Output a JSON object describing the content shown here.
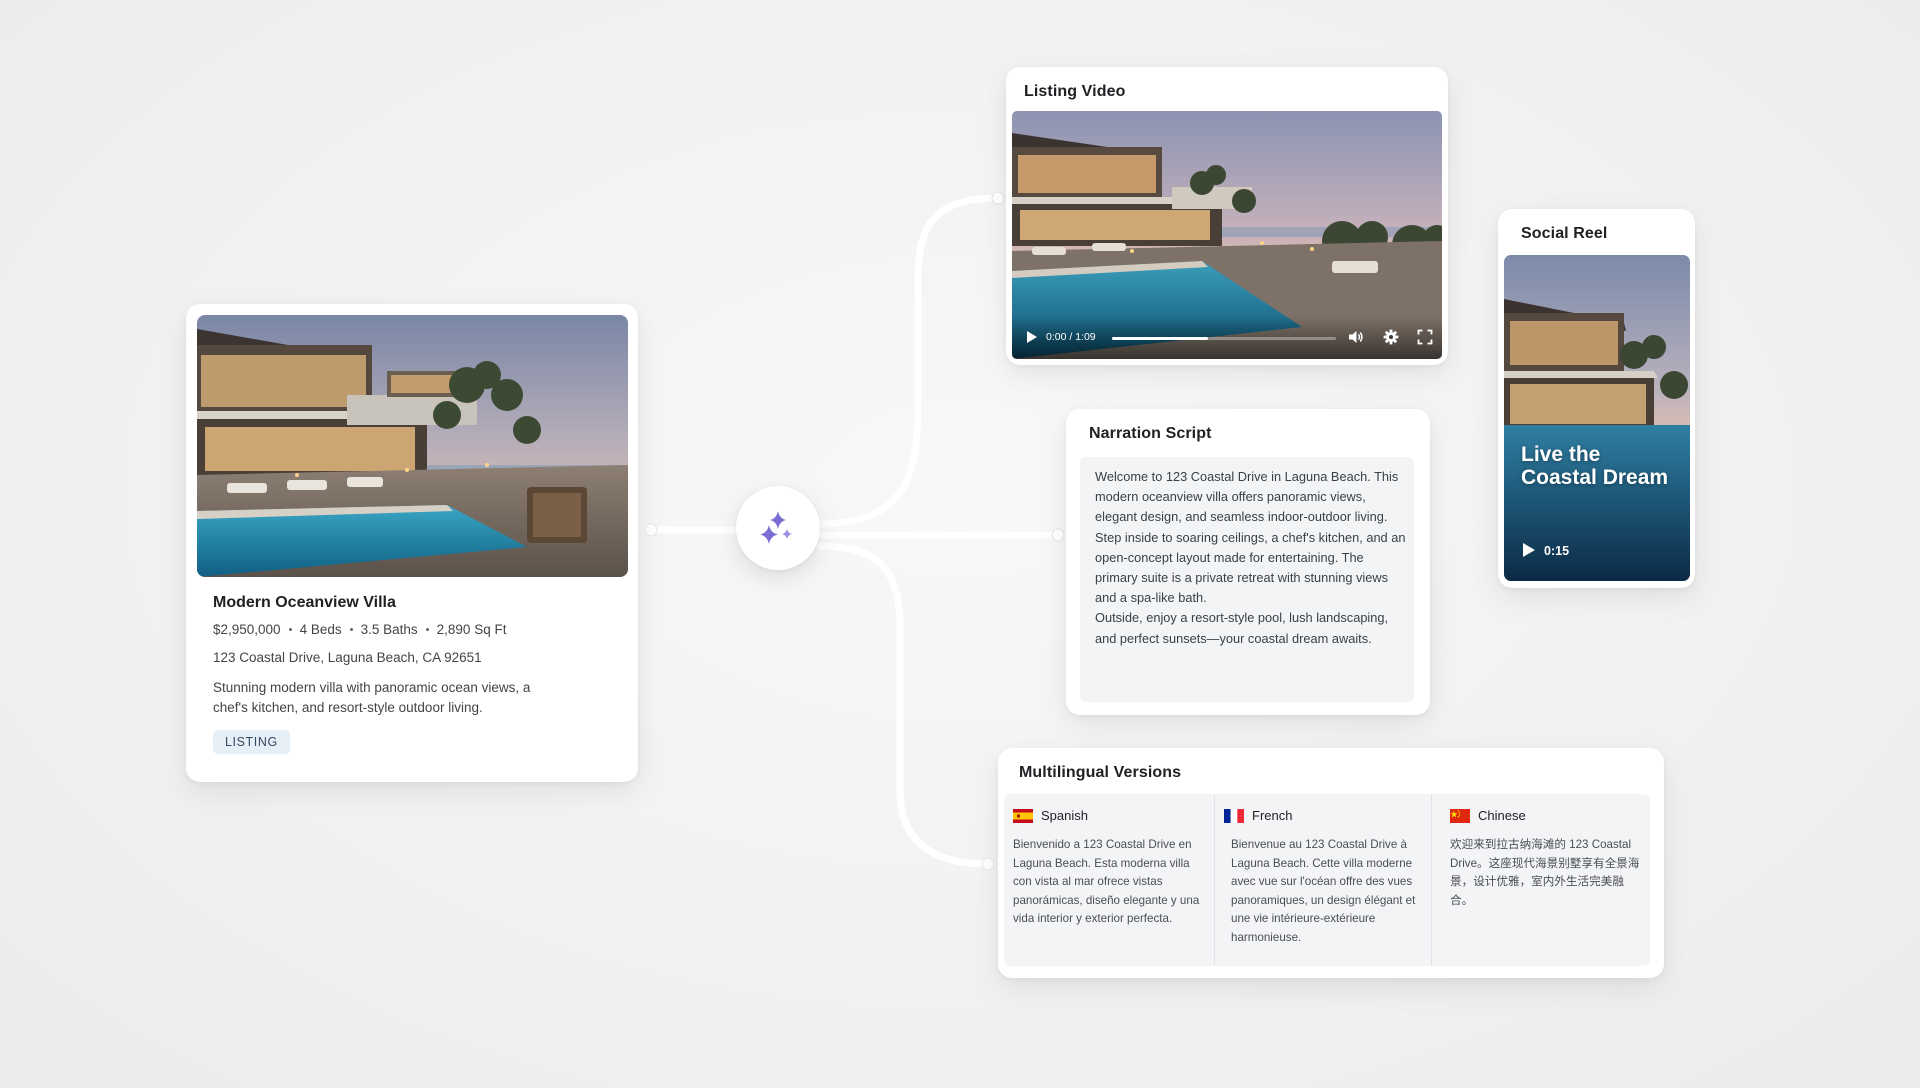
{
  "listing": {
    "title": "Modern Oceanview Villa",
    "price": "$2,950,000",
    "beds": "4 Beds",
    "baths": "3.5 Baths",
    "sqft": "2,890 Sq Ft",
    "address": "123 Coastal Drive, Laguna Beach, CA 92651",
    "description": "Stunning modern villa with panoramic ocean views, a chef's kitchen, and resort-style outdoor living.",
    "badge": "LISTING"
  },
  "ai_hub": {
    "icon": "sparkles-icon",
    "color": "#7b6fd6"
  },
  "video": {
    "title": "Listing Video",
    "time_current": "0:00",
    "time_separator": "/",
    "time_total": "1:09",
    "progress": 0.43
  },
  "reel": {
    "title": "Social Reel",
    "headline": "Live the Coastal Dream",
    "duration": "0:15"
  },
  "narration": {
    "title": "Narration Script",
    "paragraphs": [
      "Welcome to 123 Coastal Drive in Laguna Beach. This modern oceanview villa offers panoramic views, elegant design, and seamless indoor-outdoor living.",
      "Step inside to soaring ceilings, a chef's kitchen, and an open-concept layout made for entertaining. The primary suite is a private retreat with stunning views and a spa-like bath.",
      "Outside, enjoy a resort-style pool, lush landscaping, and perfect sunsets—your coastal dream awaits."
    ]
  },
  "multilingual": {
    "title": "Multilingual Versions",
    "languages": [
      {
        "name": "Spanish",
        "flag": "es-flag-icon",
        "text": "Bienvenido a 123 Coastal Drive en Laguna Beach. Esta moderna villa con vista al mar ofrece vistas panorámicas, diseño elegante y una vida interior y exterior perfecta."
      },
      {
        "name": "French",
        "flag": "fr-flag-icon",
        "text": "Bienvenue au 123 Coastal Drive à Laguna Beach. Cette villa moderne avec vue sur l'océan offre des vues panoramiques, un design élégant et une vie intérieure-extérieure harmonieuse."
      },
      {
        "name": "Chinese",
        "flag": "cn-flag-icon",
        "text": "欢迎来到拉古纳海滩的 123 Coastal Drive。这座现代海景别墅享有全景海景，设计优雅，室内外生活完美融合。"
      }
    ]
  }
}
